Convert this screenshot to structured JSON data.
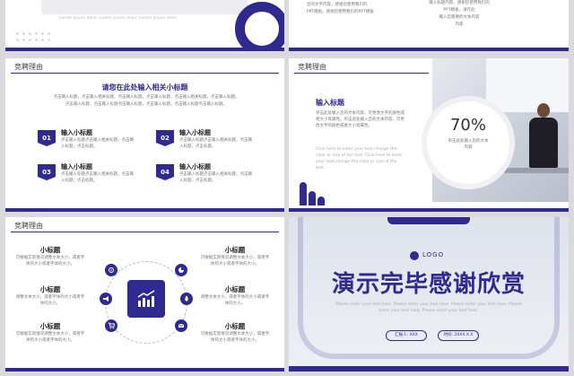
{
  "colors": {
    "primary": "#2e2a8f",
    "background": "#d9d9de"
  },
  "slide1": {
    "caption": "Lorem ipsum dolor. Lorem ipsum dolor. Lorem ipsum dolor."
  },
  "slide2": {
    "line1": "您的文字内容，感谢您使用我们的",
    "line2": "PPT模板。感谢您使用我们的PPT模板",
    "right1": "输入标题内容，感谢您使用我们的",
    "right2": "PPT模板。请在此",
    "right3": "输入您需要的文本内容",
    "right4": "内容"
  },
  "slide3": {
    "header": "竞聘理由",
    "title": "请您在此处输入相关小标题",
    "desc": [
      "点击输入标题，点击输入相关标题。点击输入标题。点击输入标题，点击输入相关标题。点击输入标题。",
      "点击输入标题，点击输入标题点击输入标题，点击输入标题，点击输入标题点击输入标题。"
    ],
    "items": [
      {
        "num": "01",
        "title": "输入小标题",
        "desc": "点击输入标题点击输入相关标题，点击输入标题，点击标题。"
      },
      {
        "num": "02",
        "title": "输入小标题",
        "desc": "点击输入标题点击输入相关标题，点击输入标题，点击标题。"
      },
      {
        "num": "03",
        "title": "输入小标题",
        "desc": "点击输入标题点击输入相关标题，点击输入标题，点击标题。"
      },
      {
        "num": "04",
        "title": "输入小标题",
        "desc": "点击输入标题点击输入相关标题，点击输入标题，点击标题。"
      }
    ]
  },
  "slide4": {
    "header": "竞聘理由",
    "title": "输入标题",
    "desc": "单击此处输入您的文本内容，可更改文字的颜色或者大小等属性。单击此处输入您的文本内容，可更改文字的颜色或者大小等属性。",
    "en": "Click here to enter your text change the color or size of the text. Click here to enter your text,change the color or size of the text.",
    "percent": "70%",
    "percent_note": "单击此处输入您的文本内容"
  },
  "slide5": {
    "header": "竞聘理由",
    "subs": [
      {
        "title": "小标题",
        "desc": "可根据实际情况调整文本大小，或者字体的大小或者字体的大小。"
      },
      {
        "title": "小标题",
        "desc": "调整文本大小，或者字体的大小或者字体的大小。"
      },
      {
        "title": "小标题",
        "desc": "可根据实际情况调整文本大小，或者字体的大小或者字体的大小。"
      },
      {
        "title": "小标题",
        "desc": "可根据实际情况调整文本大小，或者字体的大小或者字体的大小。"
      },
      {
        "title": "小标题",
        "desc": "调整文本大小，或者字体的大小或者字体的大小。"
      },
      {
        "title": "小标题",
        "desc": "可根据实际情况调整文本大小，或者字体的大小或者字体的大小。"
      }
    ]
  },
  "slide6": {
    "logo": "LOGO",
    "title": "演示完毕感谢欣赏",
    "desc": "Please enter your text here. Please enter your text here. Please enter your text here. Please enter your text here. Please enter your text here.",
    "btn1": "汇报人: XXX",
    "btn2": "时间: 20XX.X.X"
  }
}
